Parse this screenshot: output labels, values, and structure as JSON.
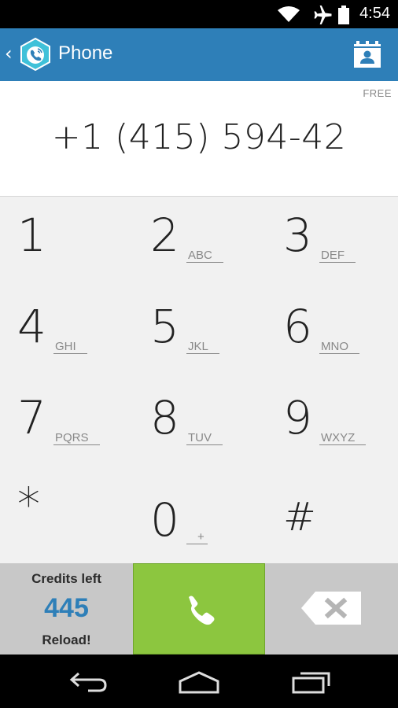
{
  "status_bar": {
    "time": "4:54",
    "icons": [
      "wifi-icon",
      "airplane-icon",
      "battery-icon"
    ]
  },
  "action_bar": {
    "back_icon": "chevron-left-icon",
    "logo_icon": "phone-app-logo-icon",
    "title": "Phone",
    "contacts_icon": "contacts-book-icon",
    "color": "#2e7fb8"
  },
  "display": {
    "free_label": "FREE",
    "number": "+1 (415) 594-42"
  },
  "keypad": {
    "keys": [
      {
        "digit": "1",
        "letters": ""
      },
      {
        "digit": "2",
        "letters": "ABC"
      },
      {
        "digit": "3",
        "letters": "DEF"
      },
      {
        "digit": "4",
        "letters": "GHI"
      },
      {
        "digit": "5",
        "letters": "JKL"
      },
      {
        "digit": "6",
        "letters": "MNO"
      },
      {
        "digit": "7",
        "letters": "PQRS"
      },
      {
        "digit": "8",
        "letters": "TUV"
      },
      {
        "digit": "9",
        "letters": "WXYZ"
      },
      {
        "digit": "*",
        "letters": ""
      },
      {
        "digit": "0",
        "letters": "+"
      },
      {
        "digit": "#",
        "letters": ""
      }
    ]
  },
  "bottom": {
    "credits_label": "Credits left",
    "credits_amount": "445",
    "reload_label": "Reload!",
    "call_icon": "phone-call-icon",
    "backspace_icon": "backspace-icon",
    "call_color": "#8cc63f",
    "credits_color": "#2e7fb8"
  },
  "nav_bar": {
    "icons": [
      "back-icon",
      "home-icon",
      "recents-icon"
    ]
  }
}
